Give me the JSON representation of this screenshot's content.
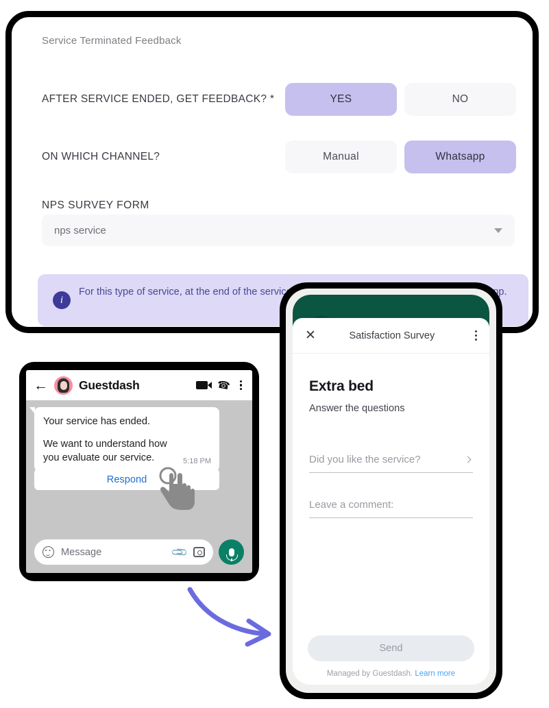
{
  "settings_card": {
    "title": "Service Terminated Feedback",
    "rows": [
      {
        "label": "AFTER SERVICE ENDED, GET FEEDBACK? *",
        "options": [
          "YES",
          "NO"
        ],
        "selected": "YES"
      },
      {
        "label": "ON WHICH CHANNEL?",
        "options": [
          "Manual",
          "Whatsapp"
        ],
        "selected": "Whatsapp"
      }
    ],
    "nps": {
      "label": "NPS SURVEY FORM",
      "value": "nps service",
      "caret_icon": "chevron-down-icon"
    },
    "info": {
      "icon": "info-icon",
      "text": "For this type of service, at the end of the service a survey will be sent to the guest via WhatsApp."
    }
  },
  "whatsapp": {
    "header": {
      "back_icon": "back-arrow-icon",
      "avatar": "avatar",
      "name": "Guestdash",
      "video_icon": "video-camera-icon",
      "call_icon": "phone-icon",
      "menu_icon": "more-vertical-icon"
    },
    "message": {
      "line1": "Your service has ended.",
      "line2": "We want to understand how",
      "line3": "you evaluate our service.",
      "time": "5:18 PM"
    },
    "respond_label": "Respond",
    "cursor_icon": "tap-hand-icon",
    "input": {
      "emoji_icon": "emoji-icon",
      "placeholder": "Message",
      "attach_icon": "paperclip-icon",
      "camera_icon": "camera-icon",
      "mic_icon": "microphone-icon"
    }
  },
  "survey": {
    "topbar": {
      "close_icon": "close-icon",
      "title": "Satisfaction Survey",
      "menu_icon": "more-vertical-icon"
    },
    "heading": "Extra bed",
    "subheading": "Answer the questions",
    "question": {
      "label": "Did you like the service?",
      "chevron_icon": "chevron-right-icon"
    },
    "comment_placeholder": "Leave a comment:",
    "send_label": "Send",
    "footer_text": "Managed by Guestdash.",
    "footer_link": "Learn more"
  },
  "colors": {
    "accent_purple": "#c6c0ef",
    "banner_bg": "#ddd9f6",
    "banner_text": "#4a4795",
    "arrow": "#6b6be0",
    "whatsapp_green": "#0a8066",
    "survey_green": "#0a5640",
    "link_blue": "#1f6fd0"
  }
}
